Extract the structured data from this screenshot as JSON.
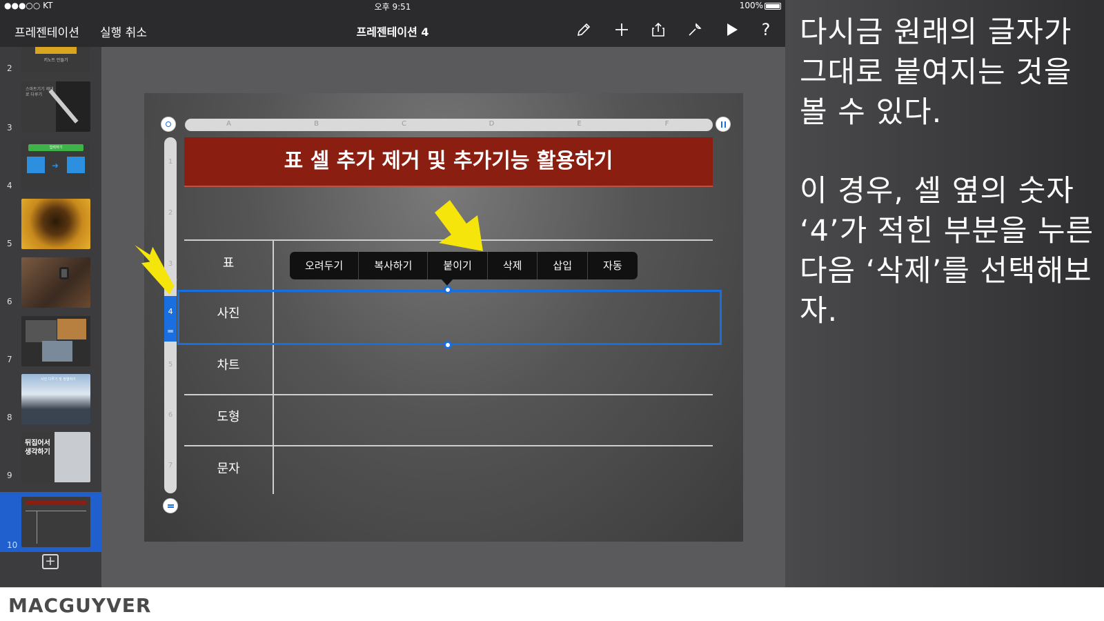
{
  "status": {
    "carrier": "●●●○○ KT",
    "time": "오후 9:51",
    "battery": "100%"
  },
  "toolbar": {
    "back_label": "프레젠테이션",
    "undo_label": "실행 취소",
    "title": "프레젠테이션 4",
    "icons": [
      "brush-icon",
      "plus-icon",
      "share-icon",
      "wrench-icon",
      "play-icon",
      "help-icon"
    ]
  },
  "sidebar": {
    "slides": [
      {
        "num": "2",
        "caption": "키노트 만들기"
      },
      {
        "num": "3",
        "caption": "스마트기기 제대로 다루기"
      },
      {
        "num": "4",
        "caption": "입력하기"
      },
      {
        "num": "5",
        "caption": ""
      },
      {
        "num": "6",
        "caption": ""
      },
      {
        "num": "7",
        "caption": ""
      },
      {
        "num": "8",
        "caption": "사진 다루기 및 정렬하기"
      },
      {
        "num": "9",
        "caption": "뒤집어서 생각하기"
      },
      {
        "num": "10",
        "caption": ""
      }
    ],
    "selected": "10"
  },
  "table": {
    "columns": [
      "A",
      "B",
      "C",
      "D",
      "E",
      "F"
    ],
    "rows": [
      "1",
      "2",
      "3",
      "4",
      "5",
      "6",
      "7"
    ],
    "title": "표 셀 추가 제거 및 추가기능 활용하기",
    "labels": [
      "표",
      "사진",
      "차트",
      "도형",
      "문자"
    ],
    "selected_row": "4"
  },
  "context_menu": [
    "오려두기",
    "복사하기",
    "붙이기",
    "삭제",
    "삽입",
    "자동"
  ],
  "colors": {
    "accent": "#1a6fe0",
    "title_bg": "#8a1f11",
    "arrow": "#f5e50a"
  },
  "panel": {
    "para1": "다시금 원래의 글자가 그대로 붙여지는 것을 볼 수 있다.",
    "para2": "이 경우, 셀 옆의 숫자 ‘4’가 적힌 부분을 누른 다음 ‘삭제’를 선택해보자."
  },
  "footer": {
    "brand": "MACGUYVER"
  }
}
